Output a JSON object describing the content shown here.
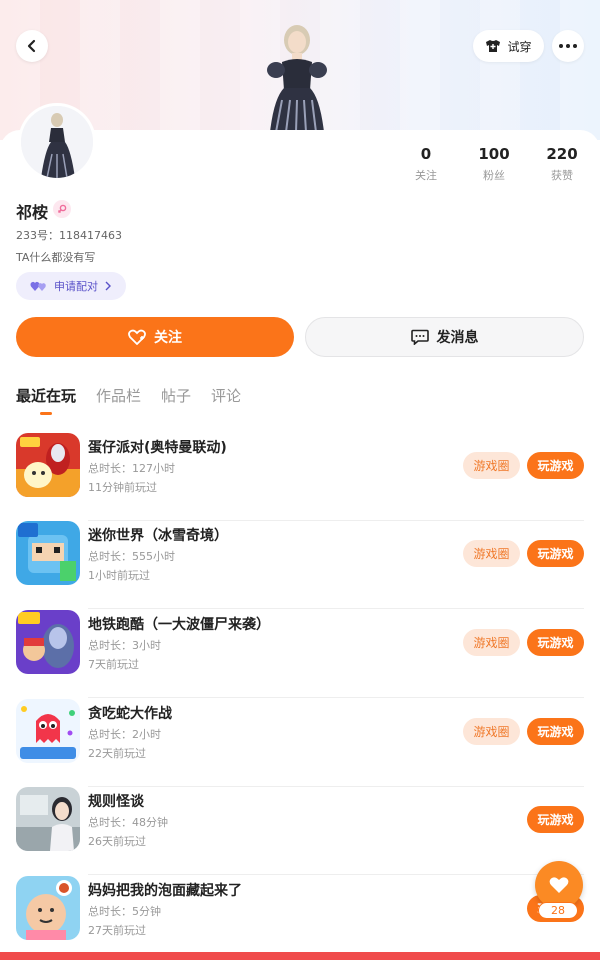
{
  "header": {
    "back_icon": "chevron-left-icon",
    "tryon_label": "试穿",
    "more_icon": "more-horizontal-icon"
  },
  "profile": {
    "name": "祁桉",
    "gender_icon": "female-icon",
    "uid": "233号：118417463",
    "bio": "TA什么都没有写",
    "pair_label": "申请配对",
    "stats": [
      {
        "num": "0",
        "label": "关注"
      },
      {
        "num": "100",
        "label": "粉丝"
      },
      {
        "num": "220",
        "label": "获赞"
      }
    ]
  },
  "actions": {
    "follow_label": "关注",
    "message_label": "发消息"
  },
  "tabs": [
    "最近在玩",
    "作品栏",
    "帖子",
    "评论"
  ],
  "games": [
    {
      "title": "蛋仔派对(奥特曼联动)",
      "duration": "总时长：127小时",
      "last_played": "11分钟前玩过",
      "circle_label": "游戏圈",
      "play_label": "玩游戏"
    },
    {
      "title": "迷你世界（冰雪奇境）",
      "duration": "总时长：555小时",
      "last_played": "1小时前玩过",
      "circle_label": "游戏圈",
      "play_label": "玩游戏"
    },
    {
      "title": "地铁跑酷（一大波僵尸来袭）",
      "duration": "总时长：3小时",
      "last_played": "7天前玩过",
      "circle_label": "游戏圈",
      "play_label": "玩游戏"
    },
    {
      "title": "贪吃蛇大作战",
      "duration": "总时长：2小时",
      "last_played": "22天前玩过",
      "circle_label": "游戏圈",
      "play_label": "玩游戏"
    },
    {
      "title": "规则怪谈",
      "duration": "总时长：48分钟",
      "last_played": "26天前玩过",
      "circle_label": "",
      "play_label": "玩游戏"
    },
    {
      "title": "妈妈把我的泡面藏起来了",
      "duration": "总时长：5分钟",
      "last_played": "27天前玩过",
      "circle_label": "",
      "play_label": "玩游戏"
    }
  ],
  "game_icon_text": {
    "icon3_badge": "7周年庆",
    "icon1_badge": "酷跑"
  },
  "fab": {
    "icon": "heart-icon",
    "count": "28"
  },
  "colors": {
    "accent": "#fb7419",
    "circle_bg": "#fde6d8",
    "pair_text": "#5a52c9"
  }
}
